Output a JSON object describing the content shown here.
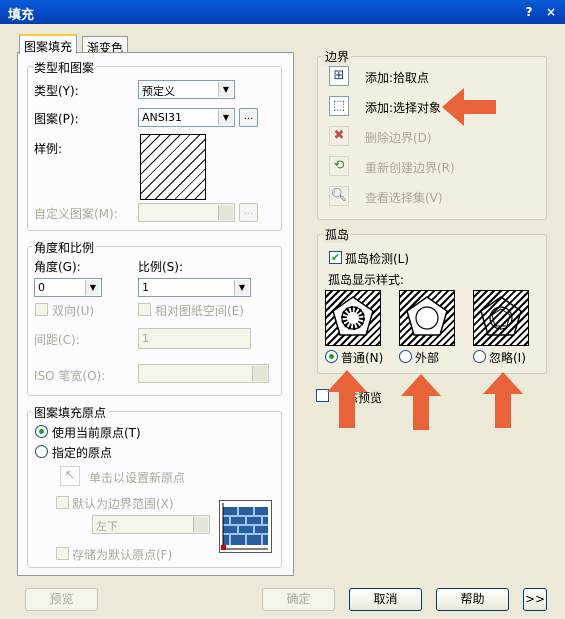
{
  "window": {
    "title": "填充",
    "help_button": "?",
    "close_button": "×"
  },
  "tabs": [
    {
      "label": "图案填充"
    },
    {
      "label": "渐变色"
    }
  ],
  "type_pattern": {
    "group_title": "类型和图案",
    "type_label": "类型(Y):",
    "type_value": "预定义",
    "pattern_label": "图案(P):",
    "pattern_value": "ANSI31",
    "pattern_browse": "...",
    "swatch_label": "样例:",
    "custom_label": "自定义图案(M):",
    "custom_value": "",
    "custom_browse": "..."
  },
  "angle_scale": {
    "group_title": "角度和比例",
    "angle_label": "角度(G):",
    "angle_value": "0",
    "scale_label": "比例(S):",
    "scale_value": "1",
    "double_label": "双向(U)",
    "relative_label": "相对图纸空间(E)",
    "spacing_label": "间距(C):",
    "spacing_value": "1",
    "iso_label": "ISO 笔宽(O):",
    "iso_value": ""
  },
  "origin": {
    "group_title": "图案填充原点",
    "use_current_label": "使用当前原点(T)",
    "specified_label": "指定的原点",
    "click_set_label": "单击以设置新原点",
    "default_extents_label": "默认为边界范围(X)",
    "extents_value": "左下",
    "store_default_label": "存储为默认原点(F)"
  },
  "boundaries": {
    "group_title": "边界",
    "items": [
      {
        "label": "添加:拾取点",
        "icon": "pick-point-icon",
        "enabled": true
      },
      {
        "label": "添加:选择对象",
        "icon": "select-objects-icon",
        "enabled": true
      },
      {
        "label": "删除边界(D)",
        "icon": "remove-boundary-icon",
        "enabled": false
      },
      {
        "label": "重新创建边界(R)",
        "icon": "recreate-boundary-icon",
        "enabled": false
      },
      {
        "label": "查看选择集(V)",
        "icon": "view-selection-icon",
        "enabled": false
      }
    ]
  },
  "islands": {
    "group_title": "孤岛",
    "detect_label": "孤岛检测(L)",
    "display_style_label": "孤岛显示样式:",
    "styles": [
      {
        "label": "普通(N)",
        "selected": true
      },
      {
        "label": "外部",
        "selected": false
      },
      {
        "label": "忽略(I)",
        "selected": false
      }
    ]
  },
  "preview_toggle_label": "态预览",
  "buttons": {
    "preview": "预览",
    "ok": "确定",
    "cancel": "取消",
    "help": "帮助",
    "more": ">>"
  },
  "colors": {
    "annotation_arrow": "#e8623a",
    "titlebar": "#0548c2",
    "dialog_bg": "#ece9d8"
  }
}
